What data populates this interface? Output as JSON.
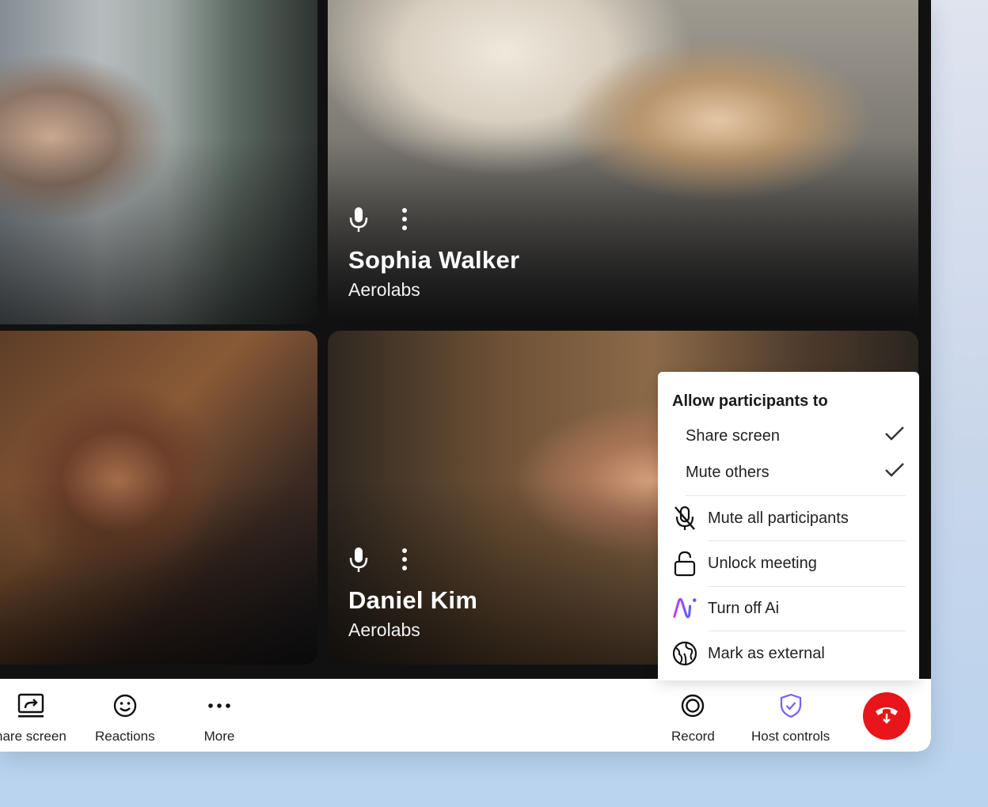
{
  "participants": [
    {
      "name": "Sophia Walker",
      "org": "Aerolabs"
    },
    {
      "name": "Daniel Kim",
      "org": "Aerolabs"
    }
  ],
  "toolbar": {
    "share_screen": "hare screen",
    "reactions": "Reactions",
    "more": "More",
    "record": "Record",
    "host_controls": "Host controls"
  },
  "menu": {
    "title": "Allow participants to",
    "permissions": [
      {
        "label": "Share screen",
        "checked": true
      },
      {
        "label": "Mute others",
        "checked": true
      }
    ],
    "actions": [
      {
        "label": "Mute all participants",
        "icon": "mic-off-icon"
      },
      {
        "label": "Unlock meeting",
        "icon": "unlock-icon"
      },
      {
        "label": "Turn off Ai",
        "icon": "ai-icon"
      },
      {
        "label": "Mark as external",
        "icon": "globe-icon"
      }
    ]
  },
  "colors": {
    "end_call": "#e8151b",
    "host_accent": "#7b5cf5",
    "ai_gradient": [
      "#c23cff",
      "#5b5cf6"
    ]
  }
}
